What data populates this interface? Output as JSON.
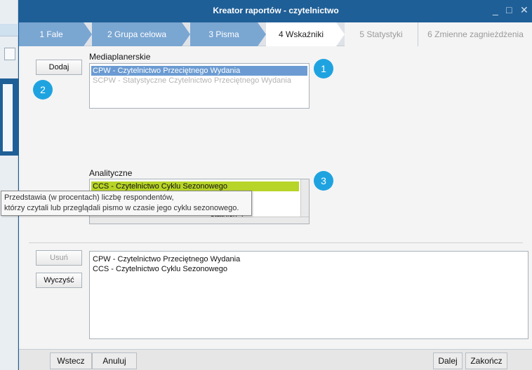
{
  "window": {
    "title": "Kreator raportów - czytelnictwo",
    "minimize": "_",
    "maximize": "□",
    "close": "✕"
  },
  "steps": [
    {
      "label": "1  Fale",
      "state": "done"
    },
    {
      "label": "2  Grupa celowa",
      "state": "done"
    },
    {
      "label": "3  Pisma",
      "state": "done"
    },
    {
      "label": "4  Wskaźniki",
      "state": "active"
    },
    {
      "label": "5  Statystyki",
      "state": "future"
    },
    {
      "label": "6  Zmienne zagnieżdżenia",
      "state": "future"
    }
  ],
  "mediaplanerskie": {
    "label": "Mediaplanerskie",
    "add_button": "Dodaj",
    "items": [
      {
        "text": "CPW - Czytelnictwo Przeciętnego Wydania",
        "selected": true
      },
      {
        "text": "SCPW - Statystyczne Czytelnictwo Przeciętnego Wydania",
        "disabled": true
      }
    ]
  },
  "analityczne": {
    "label": "Analityczne",
    "items": [
      {
        "text": "CCS - Czytelnictwo Cyklu Sezonowego",
        "highlight": true
      },
      {
        "text": "statnich 4"
      }
    ]
  },
  "tooltip": {
    "line1": "Przedstawia (w procentach) liczbę respondentów,",
    "line2": "którzy czytali lub przeglądali pismo w czasie jego cyklu sezonowego."
  },
  "selected": {
    "remove_button": "Usuń",
    "clear_button": "Wyczyść",
    "items": [
      "CPW - Czytelnictwo Przeciętnego Wydania",
      "CCS - Czytelnictwo Cyklu Sezonowego"
    ]
  },
  "badges": [
    "1",
    "2",
    "3"
  ],
  "footer": {
    "back": "Wstecz",
    "cancel": "Anuluj",
    "next": "Dalej",
    "finish": "Zakończ"
  },
  "colors": {
    "title_bar": "#1f5f97",
    "step_done": "#7aa6d2",
    "selection": "#6b9bd2",
    "highlight": "#b7d428",
    "badge": "#1fa3e0"
  }
}
